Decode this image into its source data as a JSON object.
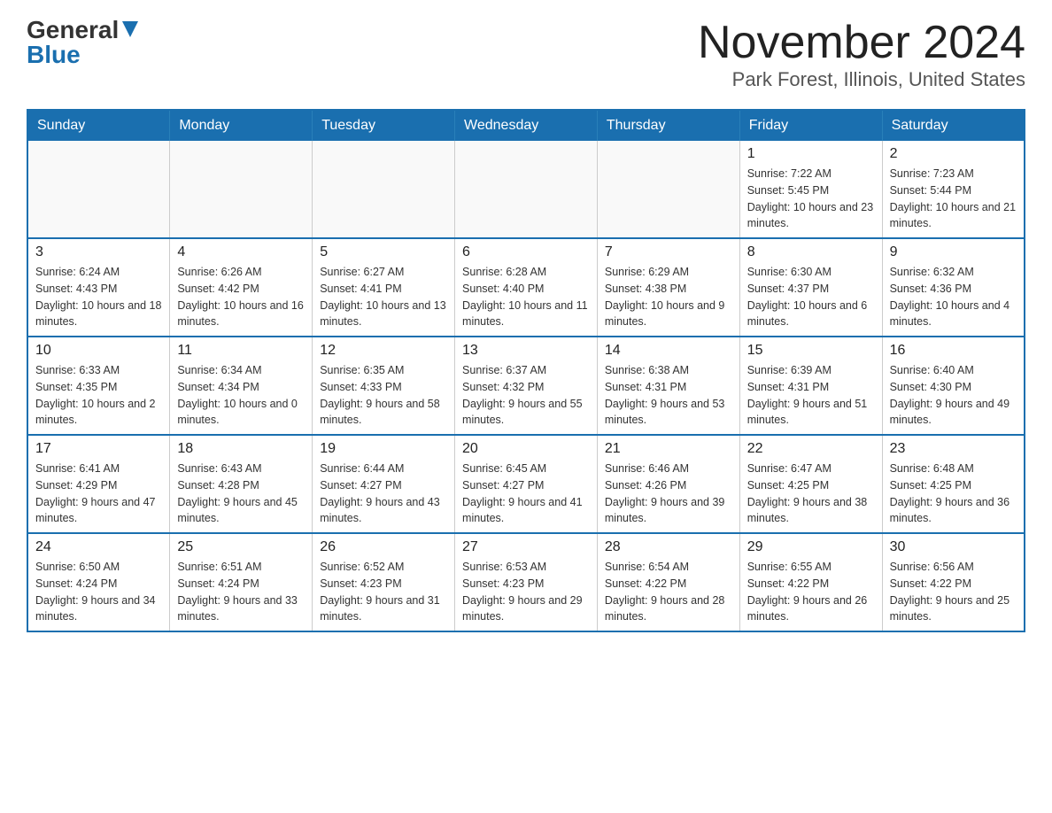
{
  "logo": {
    "general": "General",
    "blue": "Blue"
  },
  "title": "November 2024",
  "location": "Park Forest, Illinois, United States",
  "days_of_week": [
    "Sunday",
    "Monday",
    "Tuesday",
    "Wednesday",
    "Thursday",
    "Friday",
    "Saturday"
  ],
  "weeks": [
    [
      {
        "day": "",
        "info": ""
      },
      {
        "day": "",
        "info": ""
      },
      {
        "day": "",
        "info": ""
      },
      {
        "day": "",
        "info": ""
      },
      {
        "day": "",
        "info": ""
      },
      {
        "day": "1",
        "info": "Sunrise: 7:22 AM\nSunset: 5:45 PM\nDaylight: 10 hours and 23 minutes."
      },
      {
        "day": "2",
        "info": "Sunrise: 7:23 AM\nSunset: 5:44 PM\nDaylight: 10 hours and 21 minutes."
      }
    ],
    [
      {
        "day": "3",
        "info": "Sunrise: 6:24 AM\nSunset: 4:43 PM\nDaylight: 10 hours and 18 minutes."
      },
      {
        "day": "4",
        "info": "Sunrise: 6:26 AM\nSunset: 4:42 PM\nDaylight: 10 hours and 16 minutes."
      },
      {
        "day": "5",
        "info": "Sunrise: 6:27 AM\nSunset: 4:41 PM\nDaylight: 10 hours and 13 minutes."
      },
      {
        "day": "6",
        "info": "Sunrise: 6:28 AM\nSunset: 4:40 PM\nDaylight: 10 hours and 11 minutes."
      },
      {
        "day": "7",
        "info": "Sunrise: 6:29 AM\nSunset: 4:38 PM\nDaylight: 10 hours and 9 minutes."
      },
      {
        "day": "8",
        "info": "Sunrise: 6:30 AM\nSunset: 4:37 PM\nDaylight: 10 hours and 6 minutes."
      },
      {
        "day": "9",
        "info": "Sunrise: 6:32 AM\nSunset: 4:36 PM\nDaylight: 10 hours and 4 minutes."
      }
    ],
    [
      {
        "day": "10",
        "info": "Sunrise: 6:33 AM\nSunset: 4:35 PM\nDaylight: 10 hours and 2 minutes."
      },
      {
        "day": "11",
        "info": "Sunrise: 6:34 AM\nSunset: 4:34 PM\nDaylight: 10 hours and 0 minutes."
      },
      {
        "day": "12",
        "info": "Sunrise: 6:35 AM\nSunset: 4:33 PM\nDaylight: 9 hours and 58 minutes."
      },
      {
        "day": "13",
        "info": "Sunrise: 6:37 AM\nSunset: 4:32 PM\nDaylight: 9 hours and 55 minutes."
      },
      {
        "day": "14",
        "info": "Sunrise: 6:38 AM\nSunset: 4:31 PM\nDaylight: 9 hours and 53 minutes."
      },
      {
        "day": "15",
        "info": "Sunrise: 6:39 AM\nSunset: 4:31 PM\nDaylight: 9 hours and 51 minutes."
      },
      {
        "day": "16",
        "info": "Sunrise: 6:40 AM\nSunset: 4:30 PM\nDaylight: 9 hours and 49 minutes."
      }
    ],
    [
      {
        "day": "17",
        "info": "Sunrise: 6:41 AM\nSunset: 4:29 PM\nDaylight: 9 hours and 47 minutes."
      },
      {
        "day": "18",
        "info": "Sunrise: 6:43 AM\nSunset: 4:28 PM\nDaylight: 9 hours and 45 minutes."
      },
      {
        "day": "19",
        "info": "Sunrise: 6:44 AM\nSunset: 4:27 PM\nDaylight: 9 hours and 43 minutes."
      },
      {
        "day": "20",
        "info": "Sunrise: 6:45 AM\nSunset: 4:27 PM\nDaylight: 9 hours and 41 minutes."
      },
      {
        "day": "21",
        "info": "Sunrise: 6:46 AM\nSunset: 4:26 PM\nDaylight: 9 hours and 39 minutes."
      },
      {
        "day": "22",
        "info": "Sunrise: 6:47 AM\nSunset: 4:25 PM\nDaylight: 9 hours and 38 minutes."
      },
      {
        "day": "23",
        "info": "Sunrise: 6:48 AM\nSunset: 4:25 PM\nDaylight: 9 hours and 36 minutes."
      }
    ],
    [
      {
        "day": "24",
        "info": "Sunrise: 6:50 AM\nSunset: 4:24 PM\nDaylight: 9 hours and 34 minutes."
      },
      {
        "day": "25",
        "info": "Sunrise: 6:51 AM\nSunset: 4:24 PM\nDaylight: 9 hours and 33 minutes."
      },
      {
        "day": "26",
        "info": "Sunrise: 6:52 AM\nSunset: 4:23 PM\nDaylight: 9 hours and 31 minutes."
      },
      {
        "day": "27",
        "info": "Sunrise: 6:53 AM\nSunset: 4:23 PM\nDaylight: 9 hours and 29 minutes."
      },
      {
        "day": "28",
        "info": "Sunrise: 6:54 AM\nSunset: 4:22 PM\nDaylight: 9 hours and 28 minutes."
      },
      {
        "day": "29",
        "info": "Sunrise: 6:55 AM\nSunset: 4:22 PM\nDaylight: 9 hours and 26 minutes."
      },
      {
        "day": "30",
        "info": "Sunrise: 6:56 AM\nSunset: 4:22 PM\nDaylight: 9 hours and 25 minutes."
      }
    ]
  ]
}
